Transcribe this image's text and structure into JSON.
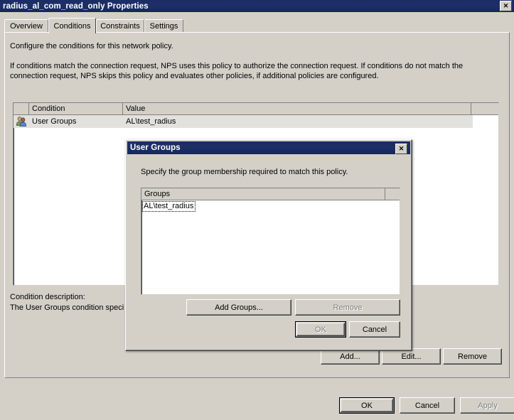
{
  "main_window": {
    "title": "radius_al_com_read_only Properties",
    "close_label": "✕",
    "tabs": [
      {
        "label": "Overview",
        "active": false
      },
      {
        "label": "Conditions",
        "active": true
      },
      {
        "label": "Constraints",
        "active": false
      },
      {
        "label": "Settings",
        "active": false
      }
    ],
    "intro_paragraph": "Configure the conditions for this network policy.",
    "description_paragraph": "If conditions match the connection request, NPS uses this policy to authorize the connection request. If conditions do not match the connection request, NPS skips this policy and evaluates other policies, if additional policies are configured.",
    "conditions_list": {
      "columns": [
        "",
        "Condition",
        "Value"
      ],
      "rows": [
        {
          "icon": "users-icon",
          "condition": "User Groups",
          "value": "AL\\test_radius",
          "selected": true
        }
      ]
    },
    "condition_description_label": "Condition description:",
    "condition_description_text": "The User Groups condition speci",
    "list_buttons": {
      "add": "Add...",
      "edit": "Edit...",
      "remove": "Remove"
    },
    "dialog_buttons": {
      "ok": "OK",
      "cancel": "Cancel",
      "apply": "Apply",
      "ok_enabled": true,
      "cancel_enabled": true,
      "apply_enabled": false
    }
  },
  "modal_dialog": {
    "title": "User Groups",
    "close_label": "✕",
    "instruction": "Specify the group membership required to match this policy.",
    "groups_list": {
      "columns": [
        "Groups",
        ""
      ],
      "rows": [
        {
          "name": "AL\\test_radius",
          "focused": true
        }
      ]
    },
    "buttons": {
      "add_groups": "Add Groups...",
      "add_groups_enabled": true,
      "remove": "Remove",
      "remove_enabled": false,
      "ok": "OK",
      "ok_enabled": false,
      "cancel": "Cancel",
      "cancel_enabled": true
    }
  },
  "colors": {
    "titlebar": "#1b2d63",
    "window_face": "#d4d0c8",
    "list_background": "#ffffff",
    "selected_row": "#e3e1dd",
    "disabled_text": "#808080"
  }
}
